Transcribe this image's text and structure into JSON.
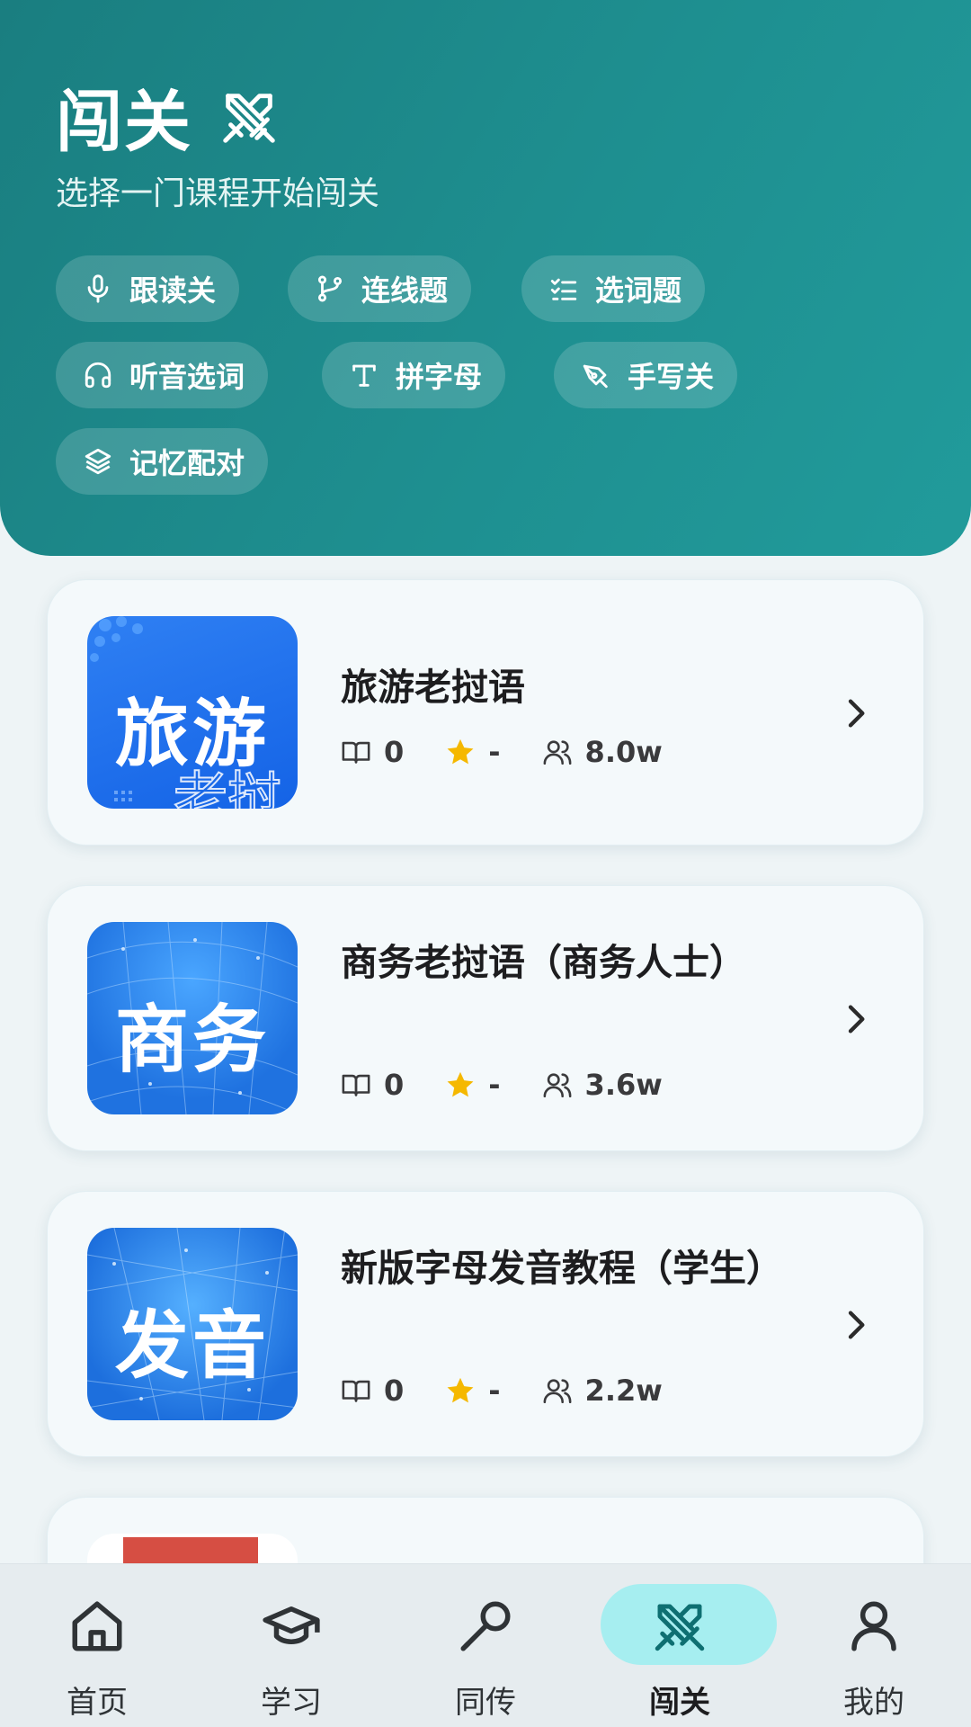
{
  "header": {
    "title": "闯关",
    "subtitle": "选择一门课程开始闯关",
    "chips": [
      {
        "label": "跟读关",
        "icon": "microphone-icon"
      },
      {
        "label": "连线题",
        "icon": "connect-line-icon"
      },
      {
        "label": "选词题",
        "icon": "checklist-icon"
      },
      {
        "label": "听音选词",
        "icon": "headphones-icon"
      },
      {
        "label": "拼字母",
        "icon": "text-t-icon"
      },
      {
        "label": "手写关",
        "icon": "pen-icon"
      },
      {
        "label": "记忆配对",
        "icon": "layers-icon"
      }
    ]
  },
  "courses": [
    {
      "name": "旅游老挝语",
      "thumb_text": "旅游",
      "lessons": "0",
      "rating": "-",
      "learners": "8.0w"
    },
    {
      "name": "商务老挝语（商务人士）",
      "thumb_text": "商务",
      "lessons": "0",
      "rating": "-",
      "learners": "3.6w"
    },
    {
      "name": "新版字母发音教程（学生）",
      "thumb_text": "发音",
      "lessons": "0",
      "rating": "-",
      "learners": "2.2w"
    }
  ],
  "nav": [
    {
      "label": "首页",
      "icon": "home-icon",
      "active": false
    },
    {
      "label": "学习",
      "icon": "graduation-cap-icon",
      "active": false
    },
    {
      "label": "同传",
      "icon": "microphone-icon",
      "active": false
    },
    {
      "label": "闯关",
      "icon": "crossed-swords-icon",
      "active": true
    },
    {
      "label": "我的",
      "icon": "user-icon",
      "active": false
    }
  ],
  "colors": {
    "header_gradient_start": "#1a7e80",
    "header_gradient_end": "#219b9b",
    "star": "#f5b800",
    "nav_active_pill": "#a6eef0",
    "nav_active_icon": "#0e6f72"
  }
}
